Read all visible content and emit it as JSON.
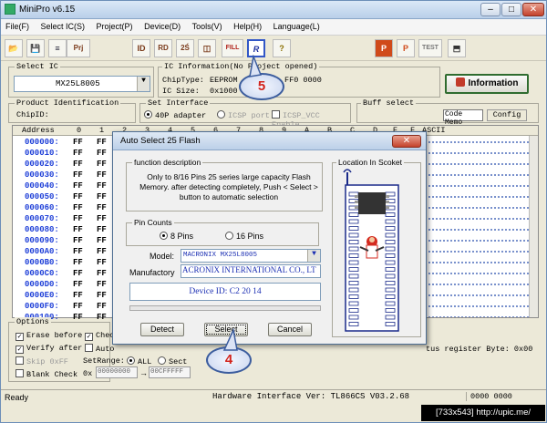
{
  "window": {
    "title": "MiniPro v6.15",
    "minimize": "–",
    "maximize": "□",
    "close": "✕"
  },
  "menu": [
    "File(F)",
    "Select IC(S)",
    "Project(P)",
    "Device(D)",
    "Tools(V)",
    "Help(H)",
    "Language(L)"
  ],
  "toolbar": {
    "buttons": [
      "open-icon",
      "save-icon",
      "load-icon",
      "save-project-icon",
      "read-id-icon",
      "read-icon",
      "verify-icon",
      "blank-check-icon",
      "fill-icon",
      "program-icon",
      "auto-select-icon",
      "help-icon",
      "project-mode-icon",
      "protect-icon",
      "test-icon",
      "config-icon"
    ],
    "labels": {
      "open": "📂",
      "save": "💾",
      "load": "≡",
      "prj": "Prj",
      "id": "ID",
      "rd": "RD",
      "v": "2Ś",
      "erase": "◫",
      "fill": "FILL",
      "p": "P",
      "r": "R",
      "q": "?",
      "pm": "P",
      "pr": "P",
      "test": "TEST",
      "cfg": "⬒"
    }
  },
  "select_ic": {
    "label": "Select IC",
    "value": "MX25L8005"
  },
  "ic_info": {
    "label": "IC Information(No Project opened)",
    "chip_type_label": "ChipType:",
    "chip_type_value": "EEPROM",
    "ic_size_label": "IC Size:",
    "ic_size_value": "0x1000",
    "right_value": "FF0 0000"
  },
  "information_button": "Information",
  "product_id": {
    "label": "Product Identification",
    "chipid_label": "ChipID:"
  },
  "interface": {
    "label": "Set Interface",
    "opt1": "40P adapter",
    "opt2": "ICSP port",
    "opt3": "ICSP_VCC Enable"
  },
  "buff": {
    "label": "Buff select",
    "code_memo": "Code Memo",
    "config": "Config"
  },
  "hex": {
    "header": {
      "address": "Address",
      "ascii": "ASCII",
      "cols": [
        "0",
        "1",
        "2",
        "3",
        "4",
        "5",
        "6",
        "7",
        "8",
        "9",
        "A",
        "B",
        "C",
        "D",
        "E",
        "F"
      ]
    },
    "rows": [
      {
        "addr": "000000:",
        "b0": "FF",
        "b1": "FF"
      },
      {
        "addr": "000010:",
        "b0": "FF",
        "b1": "FF"
      },
      {
        "addr": "000020:",
        "b0": "FF",
        "b1": "FF"
      },
      {
        "addr": "000030:",
        "b0": "FF",
        "b1": "FF"
      },
      {
        "addr": "000040:",
        "b0": "FF",
        "b1": "FF"
      },
      {
        "addr": "000050:",
        "b0": "FF",
        "b1": "FF"
      },
      {
        "addr": "000060:",
        "b0": "FF",
        "b1": "FF"
      },
      {
        "addr": "000070:",
        "b0": "FF",
        "b1": "FF"
      },
      {
        "addr": "000080:",
        "b0": "FF",
        "b1": "FF"
      },
      {
        "addr": "000090:",
        "b0": "FF",
        "b1": "FF"
      },
      {
        "addr": "0000A0:",
        "b0": "FF",
        "b1": "FF"
      },
      {
        "addr": "0000B0:",
        "b0": "FF",
        "b1": "FF"
      },
      {
        "addr": "0000C0:",
        "b0": "FF",
        "b1": "FF"
      },
      {
        "addr": "0000D0:",
        "b0": "FF",
        "b1": "FF"
      },
      {
        "addr": "0000E0:",
        "b0": "FF",
        "b1": "FF"
      },
      {
        "addr": "0000F0:",
        "b0": "FF",
        "b1": "FF"
      },
      {
        "addr": "000100:",
        "b0": "FF",
        "b1": "FF"
      }
    ]
  },
  "options": {
    "label": "Options",
    "erase_before": "Erase before",
    "check": "Chec",
    "verify_after": "Verify after",
    "auto": "Auto",
    "skip_ff": "Skip 0xFF",
    "set_range_label": "SetRange:",
    "all": "ALL",
    "sect": "Sect",
    "blank_check": "Blank Check",
    "from_prefix": "0x",
    "from_value": "00000000",
    "to_value": "00CFFFFF"
  },
  "status_register": "tus register Byte: 0x00",
  "status": {
    "left": "Ready",
    "hardware": "Hardware Interface Ver: TL866CS V03.2.68",
    "counter": "0000 0000"
  },
  "dialog": {
    "title": "Auto Select 25 Flash",
    "close": "✕",
    "func_label": "function description",
    "func_text": "Only to 8/16 Pins 25 series large capacity Flash Memory. after detecting completely, Push < Select > button to automatic selection",
    "pin_label": "Pin Counts",
    "pin8": "8 Pins",
    "pin16": "16 Pins",
    "model_label": "Model:",
    "model_value": "MACRONIX MX25L8005",
    "manuf_label": "Manufactory",
    "manuf_value": "ACRONIX INTERNATIONAL CO., LT",
    "device_id": "Device ID: C2 20 14",
    "location_label": "Location In Scoket",
    "detect": "Detect",
    "select": "Select",
    "cancel": "Cancel"
  },
  "callouts": {
    "c5": "5",
    "c4": "4"
  },
  "credit": "[733x543] http://upic.me/"
}
